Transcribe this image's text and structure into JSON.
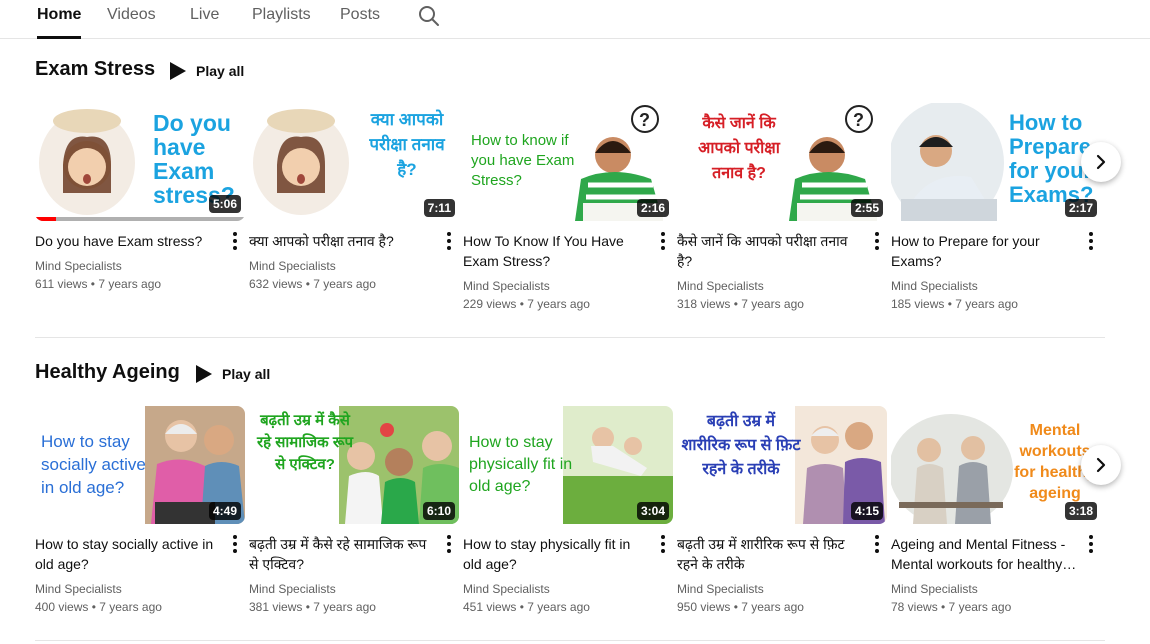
{
  "tabs": [
    {
      "label": "Home"
    },
    {
      "label": "Videos"
    },
    {
      "label": "Live"
    },
    {
      "label": "Playlists"
    },
    {
      "label": "Posts"
    }
  ],
  "search_icon": "search-icon",
  "sections": [
    {
      "title": "Exam Stress",
      "play_all": "Play all",
      "videos": [
        {
          "title": "Do you have Exam stress?",
          "channel": "Mind Specialists",
          "stats": "611 views • 7 years ago",
          "duration": "5:06",
          "watched_fraction": 0.1,
          "thumb_text": "Do you have Exam stress?"
        },
        {
          "title": "क्या आपको परीक्षा तनाव है?",
          "channel": "Mind Specialists",
          "stats": "632 views • 7 years ago",
          "duration": "7:11",
          "thumb_text": "क्या आपको परीक्षा तनाव है?"
        },
        {
          "title": "How To Know If You Have Exam Stress?",
          "channel": "Mind Specialists",
          "stats": "229 views • 7 years ago",
          "duration": "2:16",
          "thumb_text": "How to know if you have Exam Stress?"
        },
        {
          "title": "कैसे जानें कि आपको परीक्षा तनाव है?",
          "channel": "Mind Specialists",
          "stats": "318 views • 7 years ago",
          "duration": "2:55",
          "thumb_text": "कैसे जानें कि आपको परीक्षा तनाव है?"
        },
        {
          "title": "How to Prepare for your Exams?",
          "channel": "Mind Specialists",
          "stats": "185 views • 7 years ago",
          "duration": "2:17",
          "thumb_text": "How to Prepare for your Exams?"
        }
      ]
    },
    {
      "title": "Healthy Ageing",
      "play_all": "Play all",
      "videos": [
        {
          "title": "How to stay socially active in old age?",
          "channel": "Mind Specialists",
          "stats": "400 views • 7 years ago",
          "duration": "4:49",
          "thumb_text": "How to stay socially active in old age?"
        },
        {
          "title": "बढ़ती उम्र में कैसे रहे सामाजिक रूप से एक्टिव?",
          "channel": "Mind Specialists",
          "stats": "381 views • 7 years ago",
          "duration": "6:10",
          "thumb_text": "बढ़ती उम्र में कैसे रहे सामाजिक रूप से एक्टिव?"
        },
        {
          "title": "How to stay physically fit in old age?",
          "channel": "Mind Specialists",
          "stats": "451 views • 7 years ago",
          "duration": "3:04",
          "thumb_text": "How to stay physically fit in old age?"
        },
        {
          "title": "बढ़ती उम्र में शारीरिक रूप से फ़िट रहने के तरीके",
          "channel": "Mind Specialists",
          "stats": "950 views • 7 years ago",
          "duration": "4:15",
          "thumb_text": "बढ़ती उम्र में शारीरिक रूप से फ़िट रहने के तरीके"
        },
        {
          "title": "Ageing and Mental Fitness - Mental workouts for healthy…",
          "channel": "Mind Specialists",
          "stats": "78 views • 7 years ago",
          "duration": "3:18",
          "thumb_text": "Mental workouts for healthy ageing"
        }
      ]
    }
  ],
  "colors": {
    "thumb_blue": "#1ba3e0",
    "thumb_green": "#1fa51f",
    "thumb_red": "#d61f26",
    "thumb_navy": "#2a3fb5",
    "thumb_orange": "#f08a1a",
    "progress_red": "#ff0000"
  }
}
